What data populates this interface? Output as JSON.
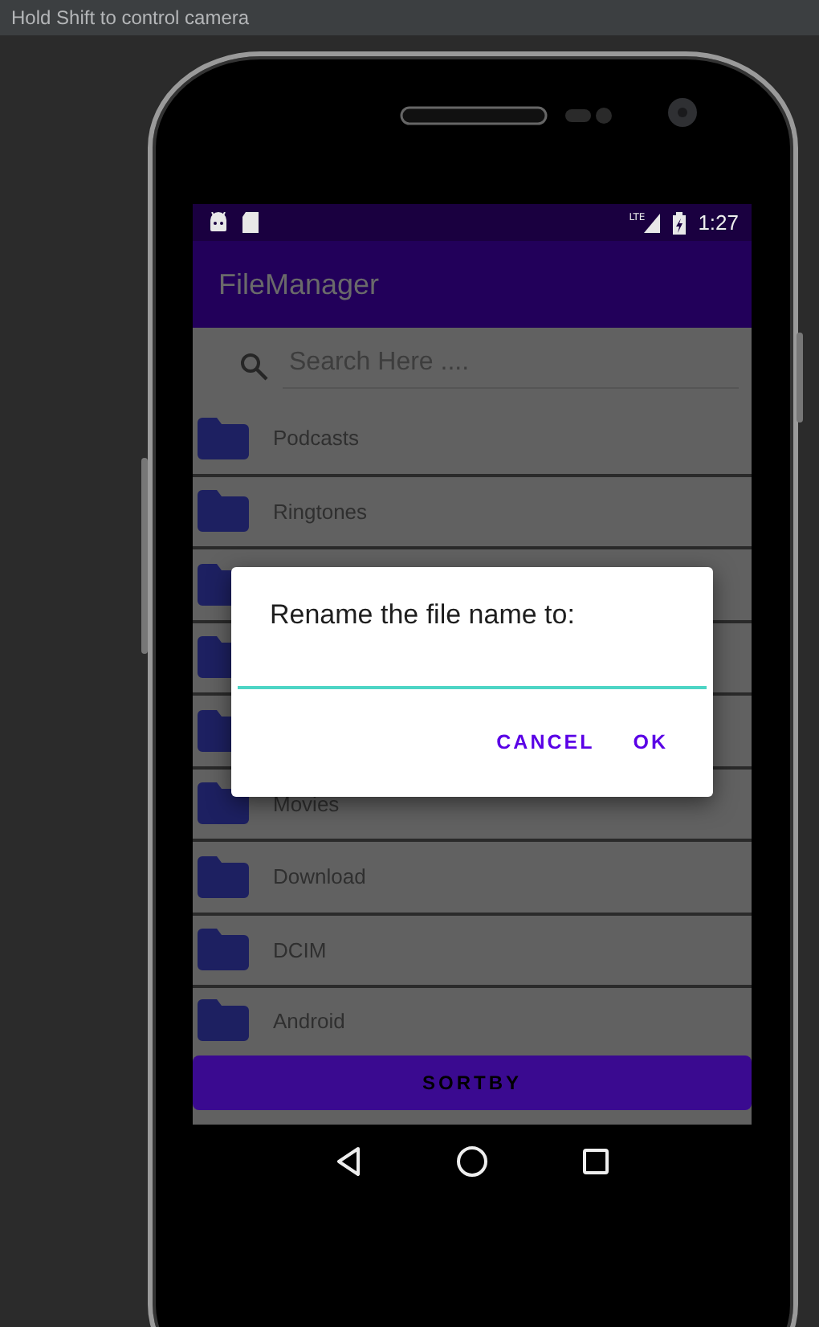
{
  "hint_bar": {
    "text": "Hold Shift to control camera"
  },
  "status_bar": {
    "time": "1:27",
    "network": "LTE"
  },
  "app_bar": {
    "title": "FileManager"
  },
  "search": {
    "placeholder": "Search Here ...."
  },
  "folders": [
    {
      "kind": "folder",
      "name": "Podcasts"
    },
    {
      "kind": "folder",
      "name": "Ringtones"
    },
    {
      "kind": "covered"
    },
    {
      "kind": "covered"
    },
    {
      "kind": "covered"
    },
    {
      "kind": "folder",
      "name": "Movies"
    },
    {
      "kind": "folder",
      "name": "Download"
    },
    {
      "kind": "folder",
      "name": "DCIM"
    },
    {
      "kind": "folder",
      "name": "Android"
    }
  ],
  "sort_button": {
    "label": "SORTBY"
  },
  "dialog": {
    "title": "Rename the file name to:",
    "buttons": [
      "CANCEL",
      "OK"
    ]
  }
}
